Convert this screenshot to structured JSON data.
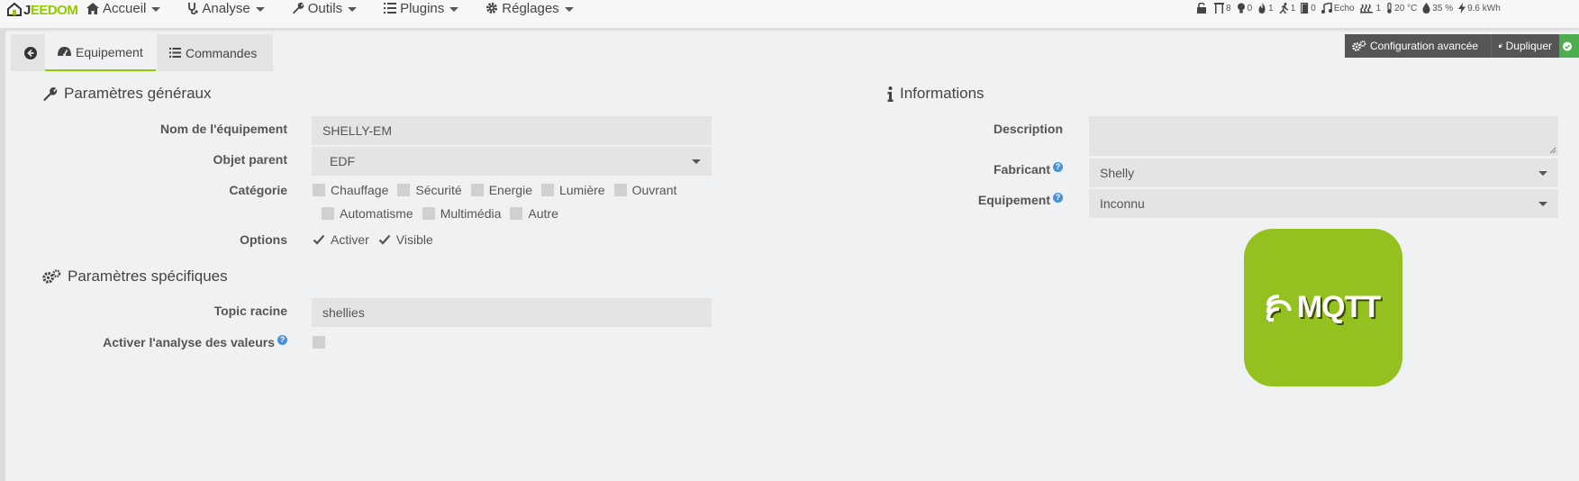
{
  "app": {
    "logo_text_a": "J",
    "logo_text_b": "EEDOM"
  },
  "nav": {
    "items": [
      {
        "label": "Accueil",
        "icon": "home-icon"
      },
      {
        "label": "Analyse",
        "icon": "stethoscope-icon"
      },
      {
        "label": "Outils",
        "icon": "wrench-icon"
      },
      {
        "label": "Plugins",
        "icon": "list-icon"
      },
      {
        "label": "Réglages",
        "icon": "gear-icon"
      }
    ]
  },
  "status": {
    "lock": "",
    "shutters": "8",
    "lights": "0",
    "fire": "1",
    "motion": "1",
    "doors": "0",
    "music": "Echo",
    "heating": "1",
    "temperature": "20 °C",
    "humidity": "35 %",
    "power": "9.6 kWh"
  },
  "tabs": {
    "equipement": "Equipement",
    "commandes": "Commandes"
  },
  "actions": {
    "config": "Configuration avancée",
    "duplicate": "Dupliquer"
  },
  "general": {
    "title": "Paramètres généraux",
    "name_label": "Nom de l'équipement",
    "name_value": "SHELLY-EM",
    "parent_label": "Objet parent",
    "parent_value": "EDF",
    "category_label": "Catégorie",
    "categories_row1": [
      "Chauffage",
      "Sécurité",
      "Energie",
      "Lumière",
      "Ouvrant"
    ],
    "categories_row2": [
      "Automatisme",
      "Multimédia",
      "Autre"
    ],
    "options_label": "Options",
    "option_activate": "Activer",
    "option_visible": "Visible"
  },
  "specific": {
    "title": "Paramètres spécifiques",
    "topic_label": "Topic racine",
    "topic_value": "shellies",
    "analysis_label": "Activer l'analyse des valeurs"
  },
  "info": {
    "title": "Informations",
    "description_label": "Description",
    "description_value": "",
    "manufacturer_label": "Fabricant",
    "manufacturer_value": "Shelly",
    "equipment_label": "Equipement",
    "equipment_value": "Inconnu",
    "logo_text": "MQTT"
  },
  "colors": {
    "accent": "#94ca02",
    "mqtt_green": "#94c11f",
    "save_green": "#4cae4c",
    "help_blue": "#4a90d9"
  }
}
